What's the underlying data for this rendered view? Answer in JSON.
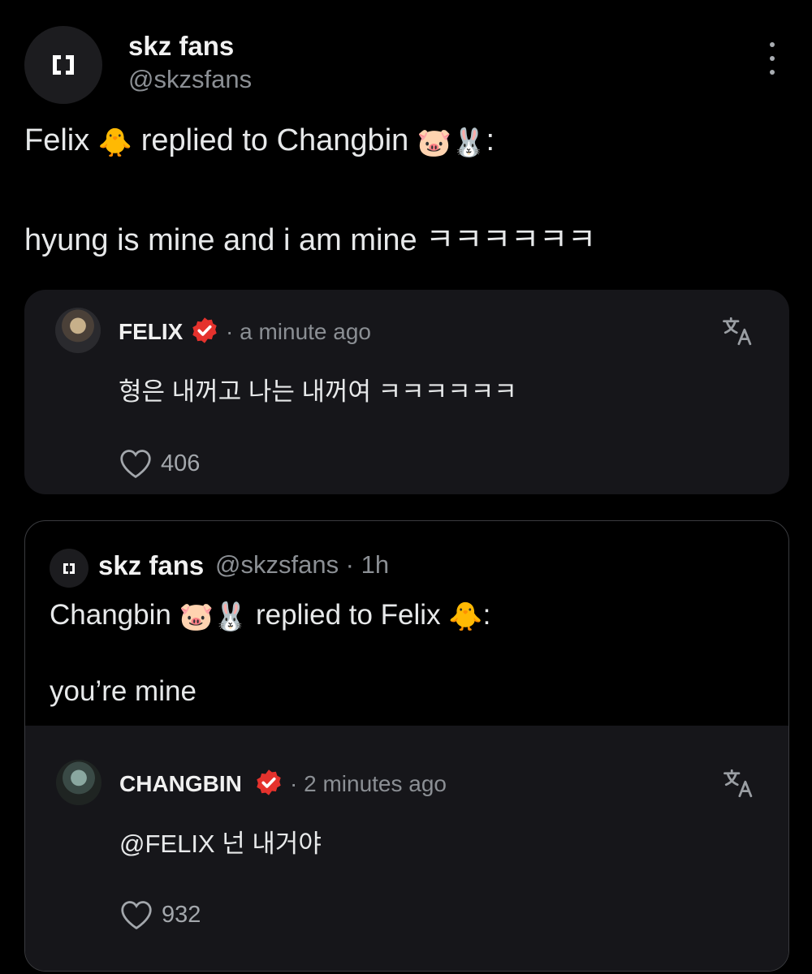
{
  "post": {
    "author_name": "skz fans",
    "author_handle": "@skzsfans",
    "line1": {
      "part1": "Felix ",
      "emoji1": "🐥",
      "part2": " replied to Changbin ",
      "emoji2": "🐷🐰",
      "part3": ":"
    },
    "line2": "hyung is mine and i am mine ㅋㅋㅋㅋㅋㅋ"
  },
  "reply_card": {
    "name": "FELIX",
    "time": "· a minute ago",
    "text": "형은 내꺼고 나는 내꺼여 ㅋㅋㅋㅋㅋㅋ",
    "likes": "406"
  },
  "quoted_post": {
    "author_name": "skz fans",
    "author_handle": "@skzsfans · 1h",
    "line1": {
      "part1": "Changbin ",
      "emoji1": "🐷🐰",
      "part2": " replied to Felix ",
      "emoji2": "🐥",
      "part3": ":"
    },
    "line2": "you’re mine",
    "reply_card": {
      "name": "CHANGBIN",
      "time": "· 2 minutes ago",
      "text": "@FELIX 넌 내거야",
      "likes": "932"
    }
  },
  "icons": {
    "more": "more-options-icon",
    "verified": "verified-badge-icon",
    "translate": "translate-icon",
    "heart": "heart-icon"
  },
  "colors": {
    "background": "#000000",
    "card": "#16161a",
    "verified_badge": "#e5322d",
    "muted_text": "#8b8f94"
  }
}
